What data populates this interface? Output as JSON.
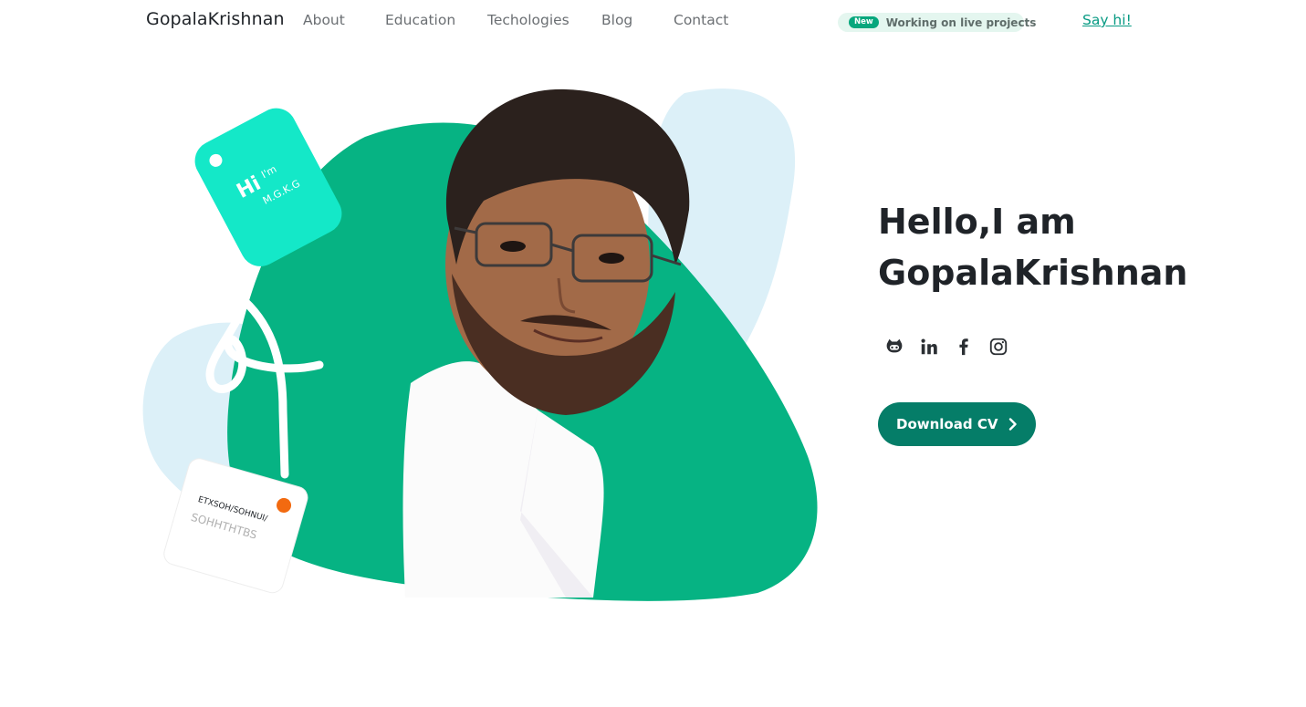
{
  "header": {
    "brand": "GopalaKrishnan",
    "nav": {
      "about": "About",
      "education": "Education",
      "technologies": "Techologies",
      "blog": "Blog",
      "contact": "Contact"
    },
    "announcement": {
      "badge": "New",
      "text": "Working on live projects"
    },
    "cta_link": "Say hi!"
  },
  "hero": {
    "heading_line1": "Hello,I am",
    "heading_line2": "GopalaKrishnan",
    "tag_text_hi": "Hi",
    "tag_text_im": "I'm",
    "tag_text_name": "M.G.K.G",
    "tag2_line1": "ETXSOH/SOHNUI/",
    "tag2_line2": "SOHHTHTBS",
    "socials": [
      {
        "icon": "github-icon"
      },
      {
        "icon": "linkedin-icon"
      },
      {
        "icon": "facebook-icon"
      },
      {
        "icon": "instagram-icon"
      }
    ],
    "download_button": "Download CV"
  },
  "colors": {
    "accent": "#057d68",
    "blob_green": "#06b383",
    "blob_light": "#dcf0f8",
    "tag_cyan": "#14e8c8",
    "dot_orange": "#f26a10"
  }
}
